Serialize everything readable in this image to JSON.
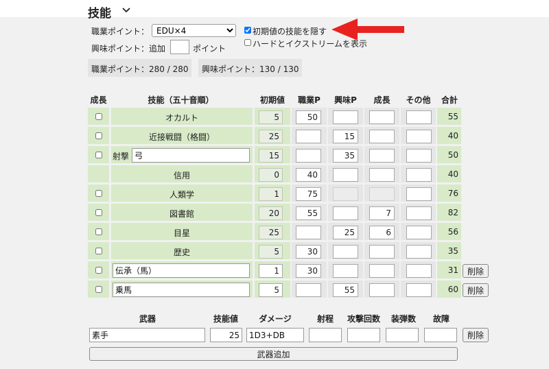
{
  "title": "技能",
  "occupation": {
    "label": "職業ポイント：",
    "selected": "EDU×4",
    "hide_initial_label": "初期値の技能を隠す",
    "hide_initial_checked": true,
    "hard_extreme_label": "ハードとイクストリームを表示",
    "hard_extreme_checked": false
  },
  "interest": {
    "label": "興味ポイント：追加",
    "add_value": "",
    "suffix": "ポイント"
  },
  "points": {
    "occupation_summary": "職業ポイント：280 / 280",
    "interest_summary": "興味ポイント：130 / 130"
  },
  "skills_table": {
    "headers": [
      "成長",
      "技能（五十音順）",
      "初期値",
      "職業P",
      "興味P",
      "成長",
      "その他",
      "合計"
    ],
    "rows": [
      {
        "name": "オカルト",
        "initial": "5",
        "occ": "50",
        "int": "",
        "growth": "",
        "other": "",
        "total": "55",
        "has_check": true
      },
      {
        "name": "近接戦闘（格闘）",
        "initial": "25",
        "occ": "",
        "int": "15",
        "growth": "",
        "other": "",
        "total": "40",
        "has_check": true
      },
      {
        "prefix": "射撃",
        "custom": "弓",
        "initial": "15",
        "occ": "",
        "int": "35",
        "growth": "",
        "other": "",
        "total": "50",
        "has_check": true
      },
      {
        "name": "信用",
        "initial": "0",
        "occ": "40",
        "int": "",
        "growth": "",
        "other": "",
        "total": "40",
        "has_check": false
      },
      {
        "name": "人類学",
        "initial": "1",
        "occ": "75",
        "int": "",
        "growth": "",
        "other": "",
        "total": "76",
        "has_check": true,
        "disabled_cols": true
      },
      {
        "name": "図書館",
        "initial": "20",
        "occ": "55",
        "int": "",
        "growth": "7",
        "other": "",
        "total": "82",
        "has_check": true
      },
      {
        "name": "目星",
        "initial": "25",
        "occ": "",
        "int": "25",
        "growth": "6",
        "other": "",
        "total": "56",
        "has_check": true
      },
      {
        "name": "歴史",
        "initial": "5",
        "occ": "30",
        "int": "",
        "growth": "",
        "other": "",
        "total": "35",
        "has_check": true
      },
      {
        "custom": "伝承（馬）",
        "initial": "1",
        "occ": "30",
        "int": "",
        "growth": "",
        "other": "",
        "total": "31",
        "has_check": true,
        "deletable": true
      },
      {
        "custom": "乗馬",
        "initial": "5",
        "occ": "",
        "int": "55",
        "growth": "",
        "other": "",
        "total": "60",
        "has_check": true,
        "deletable": true
      }
    ],
    "delete_label": "削除"
  },
  "weapons": {
    "headers": [
      "武器",
      "技能値",
      "ダメージ",
      "射程",
      "攻撃回数",
      "装弾数",
      "故障"
    ],
    "rows": [
      {
        "name": "素手",
        "skill": "25",
        "damage": "1D3+DB",
        "range": "",
        "attacks": "",
        "ammo": "",
        "malfunction": ""
      }
    ],
    "delete_label": "削除",
    "add_label": "武器追加"
  },
  "colors": {
    "row_green": "#d8eac8",
    "arrow_red": "#e8231f"
  }
}
